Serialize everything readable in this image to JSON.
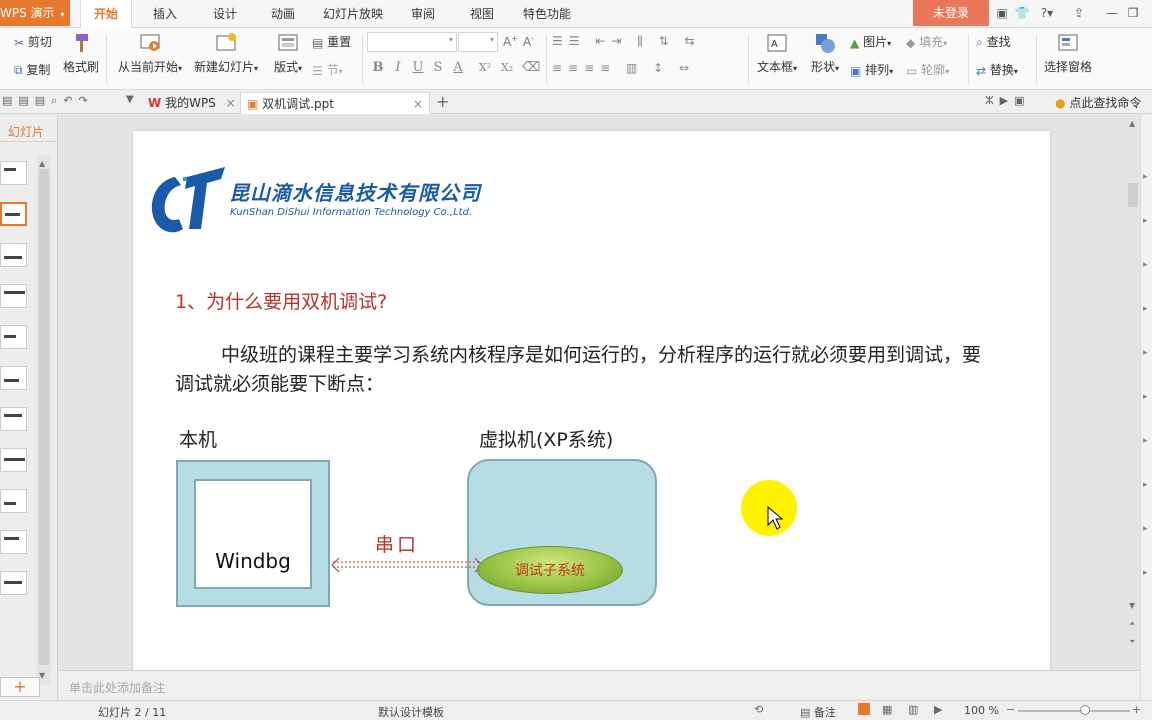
{
  "app": {
    "name": "WPS 演示",
    "login_label": "未登录"
  },
  "menu": {
    "tabs": [
      {
        "label": "开始"
      },
      {
        "label": "插入"
      },
      {
        "label": "设计"
      },
      {
        "label": "动画"
      },
      {
        "label": "幻灯片放映"
      },
      {
        "label": "审阅"
      },
      {
        "label": "视图"
      },
      {
        "label": "特色功能"
      }
    ]
  },
  "ribbon": {
    "cut": "剪切",
    "copy": "复制",
    "format_painter": "格式刷",
    "from_current": "从当前开始",
    "new_slide": "新建幻灯片",
    "layout": "版式",
    "reset": "重置",
    "section": "节",
    "textbox": "文本框",
    "shape": "形状",
    "picture": "图片",
    "fill": "填充",
    "arrange": "排列",
    "outline": "轮廓",
    "find": "查找",
    "replace": "替换",
    "selection_pane": "选择窗格",
    "format_buttons": [
      "B",
      "I",
      "U",
      "S",
      "A",
      "X²",
      "X₂"
    ]
  },
  "doc_tabs": [
    {
      "label": "我的WPS"
    },
    {
      "label": "双机调试.ppt"
    }
  ],
  "search_hint": "点此查找命令",
  "left_panel": {
    "tab_label": "幻灯片",
    "thumbnail_count": 11,
    "active_index": 1
  },
  "slide": {
    "logo_cn": "昆山滴水信息技术有限公司",
    "logo_en": "KunShan DiShui Information Technology Co.,Ltd.",
    "heading": "1、为什么要用双机调试?",
    "paragraph": "中级班的课程主要学习系统内核程序是如何运行的，分析程序的运行就必须要用到调试，要调试就必须能要下断点：",
    "host_label": "本机",
    "vm_label": "虚拟机(XP系统)",
    "host_app": "Windbg",
    "serial_label": "串口",
    "vm_subsystem": "调试子系统"
  },
  "notes_placeholder": "单击此处添加备注",
  "status": {
    "slide_info": "幻灯片 2 / 11",
    "template": "默认设计模板",
    "notes_label": "备注",
    "zoom": "100 %"
  },
  "colors": {
    "accent": "#e6792e",
    "heading_red": "#b8342a",
    "diagram_fill": "#b7dde4",
    "cursor_highlight": "#fff200"
  }
}
